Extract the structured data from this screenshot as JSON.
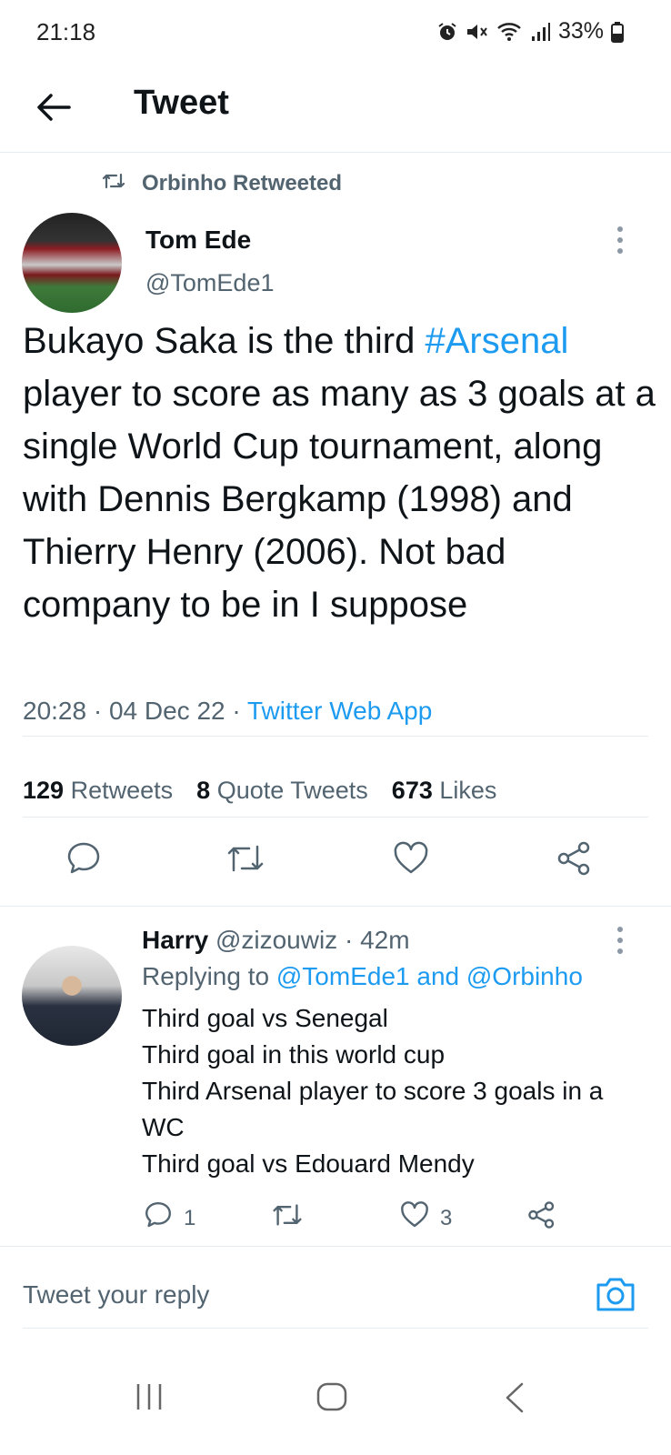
{
  "status_bar": {
    "time": "21:18",
    "battery": "33%",
    "icons": [
      "alarm-icon",
      "mute-icon",
      "wifi-icon",
      "signal-icon",
      "battery-icon"
    ]
  },
  "header": {
    "title": "Tweet",
    "back_icon": "arrow-left-icon"
  },
  "tweet": {
    "retweeted_by": "Orbinho Retweeted",
    "author_name": "Tom Ede",
    "author_handle": "@TomEde1",
    "text_before_hashtag": "Bukayo Saka is the third ",
    "hashtag": "#Arsenal",
    "text_after_hashtag": " player to score as many as 3 goals at a single World Cup tournament, along with Dennis Bergkamp (1998) and Thierry Henry (2006). Not bad company to be in I suppose",
    "timestamp": "20:28 · 04 Dec 22 · ",
    "source": "Twitter Web App",
    "stats": {
      "retweets_count": "129",
      "retweets_label": "Retweets",
      "quotes_count": "8",
      "quotes_label": "Quote Tweets",
      "likes_count": "673",
      "likes_label": "Likes"
    }
  },
  "reply": {
    "name": "Harry",
    "handle_time": " @zizouwiz · 42m",
    "replying_prefix": "Replying to ",
    "mentions": "@TomEde1 and @Orbinho",
    "lines": [
      "Third goal vs Senegal",
      "Third goal in this world cup",
      "Third Arsenal player to score 3 goals in a",
      "WC",
      "Third goal vs Edouard Mendy"
    ],
    "reply_count": "1",
    "like_count": "3"
  },
  "compose": {
    "placeholder": "Tweet your reply"
  },
  "colors": {
    "accent": "#1d9bf0",
    "secondary_text": "#536471",
    "primary_text": "#0f1419",
    "divider": "#e6ecf0"
  }
}
